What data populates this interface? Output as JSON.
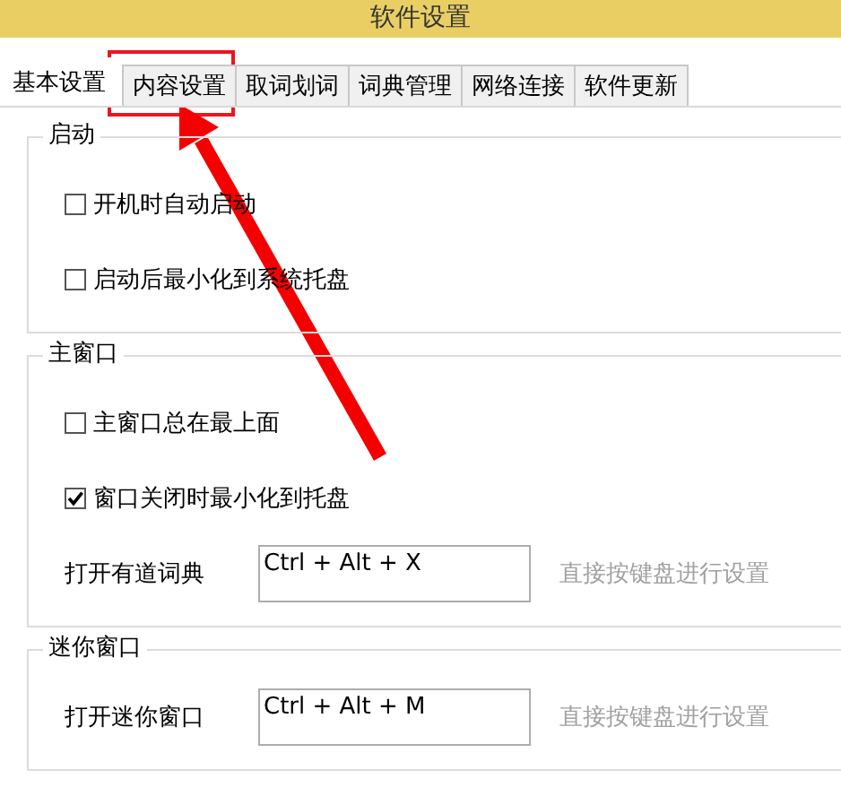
{
  "window": {
    "title": "软件设置"
  },
  "tabs": [
    {
      "label": "基本设置",
      "selected": true
    },
    {
      "label": "内容设置",
      "selected": false
    },
    {
      "label": "取词划词",
      "selected": false
    },
    {
      "label": "词典管理",
      "selected": false
    },
    {
      "label": "网络连接",
      "selected": false
    },
    {
      "label": "软件更新",
      "selected": false
    }
  ],
  "groups": [
    {
      "title": "启动",
      "items": [
        {
          "kind": "checkbox",
          "label": "开机时自动启动",
          "checked": false
        },
        {
          "kind": "checkbox",
          "label": "启动后最小化到系统托盘",
          "checked": false
        }
      ]
    },
    {
      "title": "主窗口",
      "items": [
        {
          "kind": "checkbox",
          "label": "主窗口总在最上面",
          "checked": false
        },
        {
          "kind": "checkbox",
          "label": "窗口关闭时最小化到托盘",
          "checked": true
        },
        {
          "kind": "hotkey",
          "label": "打开有道词典",
          "value": "Ctrl + Alt + X",
          "hint": "直接按键盘进行设置"
        }
      ]
    },
    {
      "title": "迷你窗口",
      "items": [
        {
          "kind": "hotkey",
          "label": "打开迷你窗口",
          "value": "Ctrl + Alt + M",
          "hint": "直接按键盘进行设置"
        }
      ]
    }
  ]
}
